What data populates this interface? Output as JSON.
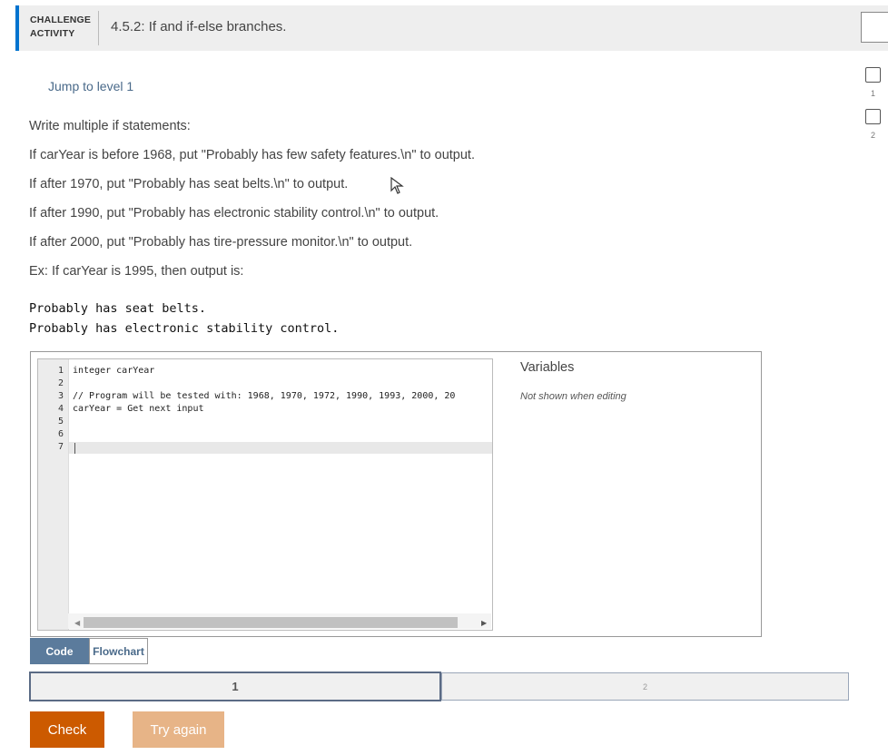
{
  "header": {
    "label_line1": "CHALLENGE",
    "label_line2": "ACTIVITY",
    "title": "4.5.2: If and if-else branches."
  },
  "levels": [
    {
      "number": "1"
    },
    {
      "number": "2"
    }
  ],
  "jump_link": "Jump to level 1",
  "instructions": [
    "Write multiple if statements:",
    "If carYear is before 1968, put \"Probably has few safety features.\\n\" to output.",
    "If after 1970, put \"Probably has seat belts.\\n\" to output.",
    "If after 1990, put \"Probably has electronic stability control.\\n\" to output.",
    "If after 2000, put \"Probably has tire-pressure monitor.\\n\" to output.",
    "Ex: If carYear is 1995, then output is:"
  ],
  "sample_output": [
    "Probably has seat belts.",
    "Probably has electronic stability control."
  ],
  "editor": {
    "lines": [
      {
        "num": "1",
        "text": "integer carYear"
      },
      {
        "num": "2",
        "text": ""
      },
      {
        "num": "3",
        "text": "// Program will be tested with: 1968, 1970, 1972, 1990, 1993, 2000, 20"
      },
      {
        "num": "4",
        "text": "carYear = Get next input"
      },
      {
        "num": "5",
        "text": ""
      },
      {
        "num": "6",
        "text": ""
      },
      {
        "num": "7",
        "text": ""
      }
    ]
  },
  "variables": {
    "title": "Variables",
    "note": "Not shown when editing"
  },
  "tabs": {
    "code": "Code",
    "flowchart": "Flowchart"
  },
  "progress": [
    {
      "label": "1"
    },
    {
      "label": "2"
    }
  ],
  "buttons": {
    "check": "Check",
    "try_again": "Try again"
  },
  "colors": {
    "accent_blue": "#0073cf",
    "check_orange": "#cc5a00",
    "try_again_orange": "#e7b487",
    "tab_active": "#5b7b9c"
  }
}
